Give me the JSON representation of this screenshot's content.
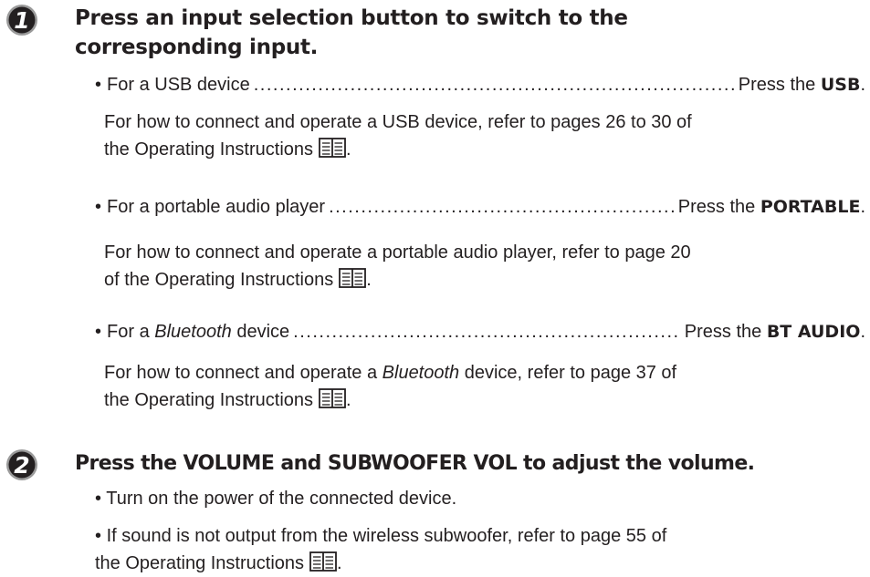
{
  "step1": {
    "number": "1",
    "heading_line1": "Press an input selection button to switch to the",
    "heading_line2": "corresponding input.",
    "usb": {
      "bullet_text": "For a USB device",
      "action_prefix": "Press the",
      "action_key": "USB",
      "desc_line1": "For how to connect and operate a USB device, refer to pages 26 to 30 of",
      "desc_line2": "the Operating Instructions"
    },
    "portable": {
      "bullet_text": "For a portable audio player",
      "action_prefix": "Press the",
      "action_key": "PORTABLE",
      "desc_line1": "For how to connect and operate a portable audio player, refer to page 20",
      "desc_line2": "of the Operating Instructions"
    },
    "bluetooth": {
      "bullet_prefix": "For a",
      "bullet_italic": "Bluetooth",
      "bullet_suffix": "device",
      "action_prefix": "Press the",
      "action_key": "BT AUDIO",
      "desc_line1_prefix": "For how to connect and operate a",
      "desc_line1_italic": "Bluetooth",
      "desc_line1_suffix": "device, refer to page 37 of",
      "desc_line2": "the Operating Instructions"
    }
  },
  "step2": {
    "number": "2",
    "heading": "Press the VOLUME and SUBWOOFER VOL to adjust the volume.",
    "note1": "Turn on the power of the connected device.",
    "note2_line1": "If sound is not output from the wireless subwoofer, refer to page 55 of",
    "note2_line2": "the Operating Instructions"
  },
  "leader": "................................................................................................................................................",
  "bullet_symbol": "•",
  "period": ".",
  "icons": {
    "step_badge": "italic-number-circle-icon",
    "manual": "open-book-icon"
  },
  "colors": {
    "text": "#231f20",
    "badge_fill": "#231f20",
    "badge_ring": "#9a9a9a"
  }
}
